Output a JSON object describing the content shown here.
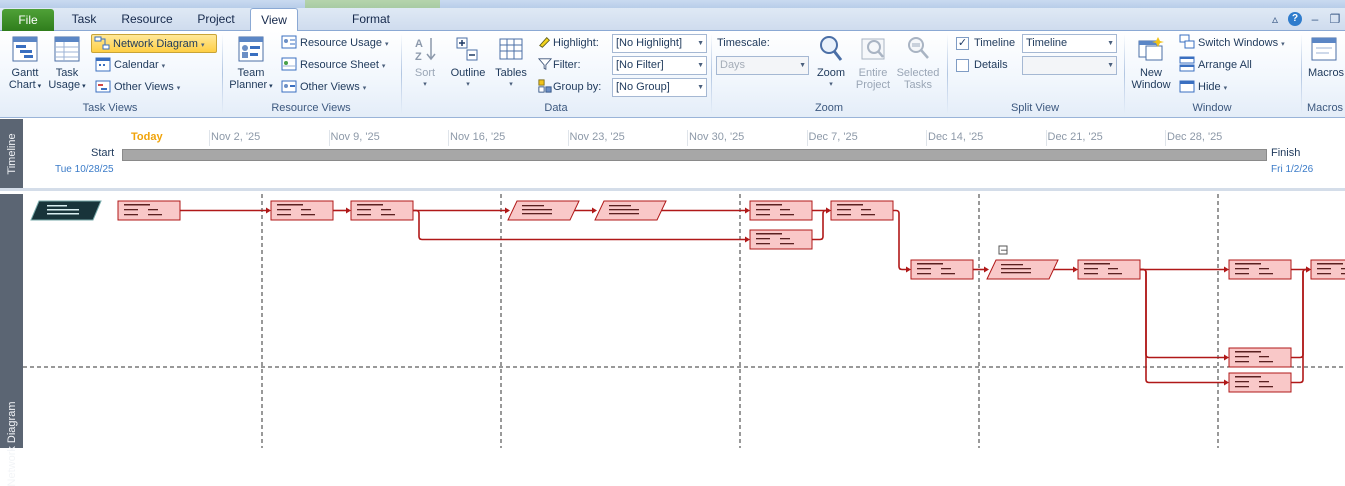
{
  "tabs": [
    {
      "label": "File"
    },
    {
      "label": "Task"
    },
    {
      "label": "Resource"
    },
    {
      "label": "Project"
    },
    {
      "label": "View"
    },
    {
      "label": "Format"
    }
  ],
  "window_controls": {
    "help": "?"
  },
  "ribbon": {
    "task_views": {
      "label": "Task Views",
      "gantt": "Gantt Chart",
      "gantt_l1": "Gantt",
      "gantt_l2": "Chart",
      "task_usage_l1": "Task",
      "task_usage_l2": "Usage",
      "network_diagram": "Network Diagram",
      "calendar": "Calendar",
      "other_views": "Other Views"
    },
    "resource_views": {
      "label": "Resource Views",
      "team_l1": "Team",
      "team_l2": "Planner",
      "resource_usage": "Resource Usage",
      "resource_sheet": "Resource Sheet",
      "other_views": "Other Views"
    },
    "data": {
      "label": "Data",
      "sort": "Sort",
      "outline": "Outline",
      "tables": "Tables",
      "highlight_label": "Highlight:",
      "highlight_value": "[No Highlight]",
      "filter_label": "Filter:",
      "filter_value": "[No Filter]",
      "groupby_label": "Group by:",
      "groupby_value": "[No Group]"
    },
    "zoom": {
      "label": "Zoom",
      "timescale_label": "Timescale:",
      "timescale_value": "Days",
      "zoom": "Zoom",
      "entire_l1": "Entire",
      "entire_l2": "Project",
      "selected_l1": "Selected",
      "selected_l2": "Tasks"
    },
    "split_view": {
      "label": "Split View",
      "timeline_label": "Timeline",
      "timeline_checked": true,
      "timeline_value": "Timeline",
      "details_label": "Details",
      "details_checked": false,
      "details_value": ""
    },
    "window": {
      "label": "Window",
      "new_l1": "New",
      "new_l2": "Window",
      "switch_windows": "Switch Windows",
      "arrange_all": "Arrange All",
      "hide": "Hide"
    },
    "macros": {
      "label": "Macros",
      "macros": "Macros"
    }
  },
  "timeline": {
    "pane_label": "Timeline",
    "today_label": "Today",
    "ticks": [
      "Nov 2, '25",
      "Nov 9, '25",
      "Nov 16, '25",
      "Nov 23, '25",
      "Nov 30, '25",
      "Dec 7, '25",
      "Dec 14, '25",
      "Dec 21, '25",
      "Dec 28, '25"
    ],
    "start_label": "Start",
    "start_date": "Tue 10/28/25",
    "finish_label": "Finish",
    "finish_date": "Fri 1/2/26"
  },
  "network": {
    "pane_label": "Network Diagram",
    "collapse_marker": "−",
    "colors": {
      "critical_fill": "#f9c8c8",
      "critical_border": "#b01818",
      "link": "#b01818",
      "summary_fill": "#18343a"
    },
    "nodes": [
      {
        "id": "n0",
        "shape": "summary",
        "col": 0,
        "row": 0
      },
      {
        "id": "n1",
        "shape": "box",
        "col": 1,
        "row": 0
      },
      {
        "id": "n2",
        "shape": "box",
        "col": 2,
        "row": 0
      },
      {
        "id": "n3",
        "shape": "box",
        "col": 3,
        "row": 0
      },
      {
        "id": "n4",
        "shape": "milestone",
        "col": 4,
        "row": 0
      },
      {
        "id": "n5",
        "shape": "milestone",
        "col": 5,
        "row": 0
      },
      {
        "id": "n6",
        "shape": "box",
        "col": 6,
        "row": 0
      },
      {
        "id": "n7",
        "shape": "box",
        "col": 6,
        "row": 1
      },
      {
        "id": "n8",
        "shape": "box",
        "col": 7,
        "row": 0
      },
      {
        "id": "n9",
        "shape": "box",
        "col": 8,
        "row": 2
      },
      {
        "id": "n10",
        "shape": "milestone",
        "col": 9,
        "row": 2
      },
      {
        "id": "n11",
        "shape": "box",
        "col": 10,
        "row": 2
      },
      {
        "id": "n12",
        "shape": "box",
        "col": 11,
        "row": 2
      },
      {
        "id": "n13",
        "shape": "box",
        "col": 12,
        "row": 2
      },
      {
        "id": "n14",
        "shape": "box",
        "col": 11,
        "row": 3
      },
      {
        "id": "n15",
        "shape": "box",
        "col": 11,
        "row": 4
      }
    ],
    "links": [
      [
        "n1",
        "n2"
      ],
      [
        "n2",
        "n3"
      ],
      [
        "n3",
        "n4"
      ],
      [
        "n4",
        "n5"
      ],
      [
        "n5",
        "n6"
      ],
      [
        "n3",
        "n7"
      ],
      [
        "n6",
        "n8"
      ],
      [
        "n7",
        "n8"
      ],
      [
        "n8",
        "n9"
      ],
      [
        "n9",
        "n10"
      ],
      [
        "n10",
        "n11"
      ],
      [
        "n11",
        "n12"
      ],
      [
        "n12",
        "n13"
      ],
      [
        "n11",
        "n14"
      ],
      [
        "n11",
        "n15"
      ],
      [
        "n14",
        "n13"
      ],
      [
        "n15",
        "n13"
      ]
    ]
  }
}
